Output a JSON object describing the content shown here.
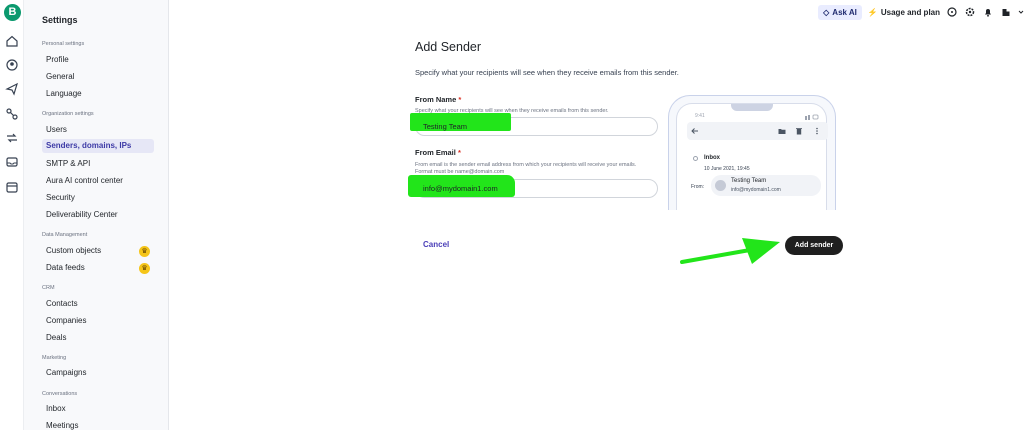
{
  "rail": {
    "logo": "B",
    "icons": [
      "home-icon",
      "contacts-icon",
      "send-icon",
      "automation-icon",
      "conversations-icon",
      "inbox-icon",
      "calendar-icon"
    ]
  },
  "sidebar": {
    "title": "Settings",
    "sections": [
      {
        "label": "Personal settings",
        "items": [
          {
            "label": "Profile"
          },
          {
            "label": "General"
          },
          {
            "label": "Language"
          }
        ]
      },
      {
        "label": "Organization settings",
        "items": [
          {
            "label": "Users"
          },
          {
            "label": "Senders, domains, IPs",
            "active": true
          },
          {
            "label": "SMTP & API"
          },
          {
            "label": "Aura AI control center"
          },
          {
            "label": "Security"
          },
          {
            "label": "Deliverability Center"
          }
        ]
      },
      {
        "label": "Data Management",
        "items": [
          {
            "label": "Custom objects",
            "badge": "crown-icon"
          },
          {
            "label": "Data feeds",
            "badge": "crown-icon"
          }
        ]
      },
      {
        "label": "CRM",
        "items": [
          {
            "label": "Contacts"
          },
          {
            "label": "Companies"
          },
          {
            "label": "Deals"
          }
        ]
      },
      {
        "label": "Marketing",
        "items": [
          {
            "label": "Campaigns"
          }
        ]
      },
      {
        "label": "Conversations",
        "items": [
          {
            "label": "Inbox"
          },
          {
            "label": "Meetings"
          }
        ]
      }
    ]
  },
  "topbar": {
    "ask_ai": "Ask AI",
    "usage": "Usage and plan",
    "icons": [
      "help-icon",
      "settings-icon",
      "bell-icon",
      "building-icon"
    ]
  },
  "form": {
    "title": "Add Sender",
    "description": "Specify what your recipients will see when they receive emails from this sender.",
    "from_name": {
      "label": "From Name",
      "required": "*",
      "help": "Specify what your recipients will see when they receive emails from this sender.",
      "value": "Testing Team"
    },
    "from_email": {
      "label": "From Email",
      "required": "*",
      "help_line1": "From email is the sender email address from which your recipients will receive your emails.",
      "help_line2": "Format must be name@domain.com",
      "value": "info@mydomain1.com"
    },
    "cancel": "Cancel",
    "submit": "Add sender"
  },
  "preview": {
    "time": "9:41",
    "folder": "Inbox",
    "date": "10 June 2021, 19:45",
    "from_label": "From:",
    "sender_name": "Testing Team",
    "sender_email": "info@mydomain1.com"
  },
  "colors": {
    "highlight": "#22e51a",
    "accent": "#3d3aa6",
    "button": "#1f1f1f"
  }
}
